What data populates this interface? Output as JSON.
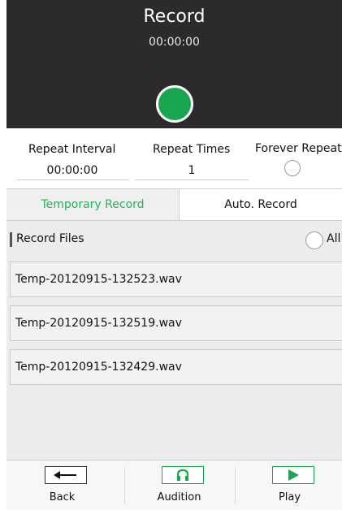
{
  "recorder": {
    "title": "Record",
    "elapsed": "00:00:00"
  },
  "settings": {
    "repeat_interval_label": "Repeat Interval",
    "repeat_interval_value": "00:00:00",
    "repeat_times_label": "Repeat Times",
    "repeat_times_value": "1",
    "forever_repeat_label": "Forever Repeat"
  },
  "tabs": [
    {
      "label": "Temporary Record",
      "active": true
    },
    {
      "label": "Auto. Record",
      "active": false
    }
  ],
  "files": {
    "header": "Record Files",
    "all_label": "All",
    "items": [
      "Temp-20120915-132523.wav",
      "Temp-20120915-132519.wav",
      "Temp-20120915-132429.wav"
    ]
  },
  "toolbar": {
    "back_label": "Back",
    "audition_label": "Audition",
    "play_label": "Play"
  },
  "colors": {
    "accent_green": "#1aa64f",
    "active_tab_text": "#25b25a",
    "panel_dark": "#2b2b2b"
  },
  "icons": {
    "record": "record-circle-icon",
    "back": "arrow-left-icon",
    "audition": "headphones-icon",
    "play": "play-triangle-icon"
  }
}
